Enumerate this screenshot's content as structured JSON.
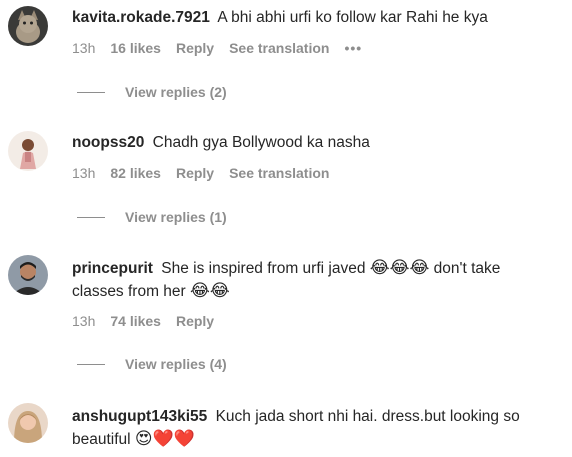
{
  "comments": [
    {
      "username": "kavita.rokade.7921",
      "text": "A bhi abhi urfi ko follow kar Rahi he kya",
      "time": "13h",
      "likes": "16 likes",
      "reply": "Reply",
      "translate": "See translation",
      "more": "•••",
      "view_replies": "View replies (2)",
      "avatar_icon": "cat-avatar-icon"
    },
    {
      "username": "noopss20",
      "text": "Chadh gya Bollywood ka nasha",
      "time": "13h",
      "likes": "82 likes",
      "reply": "Reply",
      "translate": "See translation",
      "view_replies": "View replies (1)",
      "avatar_icon": "person-avatar-icon"
    },
    {
      "username": "princepurit",
      "text": "She is inspired from urfi javed",
      "emoji_a": "😂😂😂",
      "text2": "don't take classes from her",
      "emoji_b": "😂😂",
      "time": "13h",
      "likes": "74 likes",
      "reply": "Reply",
      "view_replies": "View replies (4)",
      "avatar_icon": "man-avatar-icon"
    },
    {
      "username": "anshugupt143ki55",
      "text": "Kuch jada short nhi hai. dress.but looking so beautiful",
      "emoji": "😍❤️❤️",
      "avatar_icon": "woman-avatar-icon"
    }
  ]
}
